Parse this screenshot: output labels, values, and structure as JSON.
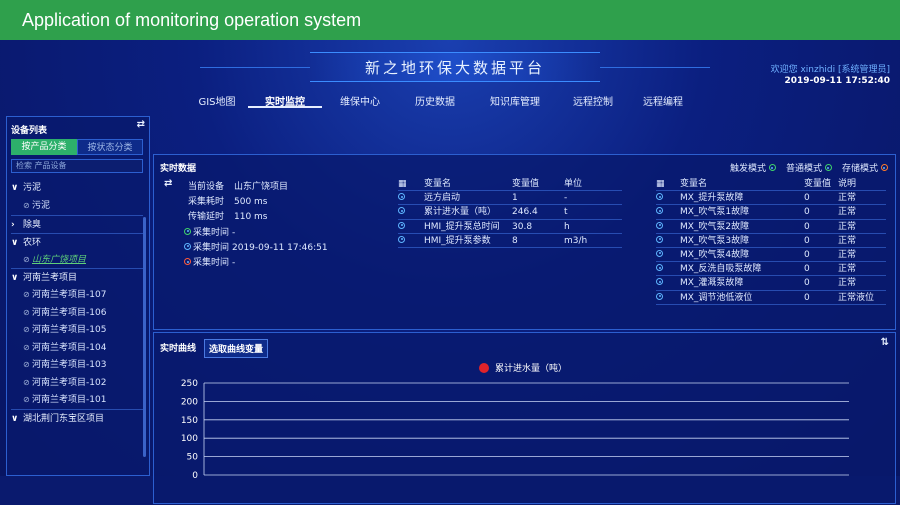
{
  "page": {
    "caption": "Application of monitoring operation system"
  },
  "header": {
    "title": "新之地环保大数据平台",
    "welcome": "欢迎您  xinzhidi [系统管理员]",
    "datetime": "2019-09-11 17:52:40"
  },
  "nav": [
    {
      "label": "GIS地图",
      "active": false
    },
    {
      "label": "实时监控",
      "active": true
    },
    {
      "label": "维保中心",
      "active": false
    },
    {
      "label": "历史数据",
      "active": false
    },
    {
      "label": "知识库管理",
      "active": false
    },
    {
      "label": "远程控制",
      "active": false
    },
    {
      "label": "远程编程",
      "active": false
    }
  ],
  "sidebar": {
    "title": "设备列表",
    "tabs": [
      {
        "label": "按产品分类",
        "active": true
      },
      {
        "label": "按状态分类",
        "active": false
      }
    ],
    "search_placeholder": "检索 产品设备",
    "tree": [
      {
        "type": "group",
        "label": "污泥",
        "expanded": true
      },
      {
        "type": "leaf",
        "label": "污泥"
      },
      {
        "type": "group",
        "label": "除臭",
        "expanded": false
      },
      {
        "type": "group",
        "label": "农环",
        "expanded": true
      },
      {
        "type": "leaf",
        "label": "山东广饶项目",
        "selected": true
      },
      {
        "type": "group",
        "label": "河南兰考项目",
        "expanded": true
      },
      {
        "type": "leaf",
        "label": "河南兰考项目-107"
      },
      {
        "type": "leaf",
        "label": "河南兰考项目-106"
      },
      {
        "type": "leaf",
        "label": "河南兰考项目-105"
      },
      {
        "type": "leaf",
        "label": "河南兰考项目-104"
      },
      {
        "type": "leaf",
        "label": "河南兰考项目-103"
      },
      {
        "type": "leaf",
        "label": "河南兰考项目-102"
      },
      {
        "type": "leaf",
        "label": "河南兰考项目-101"
      },
      {
        "type": "group",
        "label": "湖北荆门东宝区项目",
        "expanded": true
      }
    ]
  },
  "realtime": {
    "title": "实时数据",
    "modes": [
      {
        "label": "触发模式",
        "color": "#3fd46a"
      },
      {
        "label": "普通模式",
        "color": "#3fd46a"
      },
      {
        "label": "存储模式",
        "color": "#ff7a2a"
      }
    ],
    "info": [
      {
        "key": "当前设备",
        "value": "山东广饶项目",
        "marker": ""
      },
      {
        "key": "采集耗时",
        "value": "500 ms",
        "marker": ""
      },
      {
        "key": "传输延时",
        "value": "110 ms",
        "marker": ""
      },
      {
        "key": "采集时间",
        "value": "-",
        "marker": "green"
      },
      {
        "key": "采集时间",
        "value": "2019-09-11 17:46:51",
        "marker": "blue"
      },
      {
        "key": "采集时间",
        "value": "-",
        "marker": "red"
      }
    ],
    "table1": {
      "headers": [
        "变量名",
        "变量值",
        "单位"
      ],
      "rows": [
        [
          "远方启动",
          "1",
          "-"
        ],
        [
          "累计进水量（吨）",
          "246.4",
          "t"
        ],
        [
          "HMI_提升泵总时间",
          "30.8",
          "h"
        ],
        [
          "HMI_提升泵参数",
          "8",
          "m3/h"
        ]
      ]
    },
    "table2": {
      "headers": [
        "变量名",
        "变量值",
        "说明"
      ],
      "rows": [
        [
          "MX_提升泵故障",
          "0",
          "正常"
        ],
        [
          "MX_吹气泵1故障",
          "0",
          "正常"
        ],
        [
          "MX_吹气泵2故障",
          "0",
          "正常"
        ],
        [
          "MX_吹气泵3故障",
          "0",
          "正常"
        ],
        [
          "MX_吹气泵4故障",
          "0",
          "正常"
        ],
        [
          "MX_反洗自吸泵故障",
          "0",
          "正常"
        ],
        [
          "MX_灌溉泵故障",
          "0",
          "正常"
        ],
        [
          "MX_调节池低液位",
          "0",
          "正常液位"
        ]
      ]
    }
  },
  "curve": {
    "title": "实时曲线",
    "select_label": "选取曲线变量",
    "legend": "累计进水量（吨）"
  },
  "chart_data": {
    "type": "line",
    "series": [
      {
        "name": "累计进水量（吨）",
        "values": []
      }
    ],
    "ylim": [
      0,
      250
    ],
    "yticks": [
      0,
      50,
      100,
      150,
      200,
      250
    ],
    "grid": true,
    "legend_position": "top-center",
    "colors": {
      "series": "#e0232a"
    }
  }
}
